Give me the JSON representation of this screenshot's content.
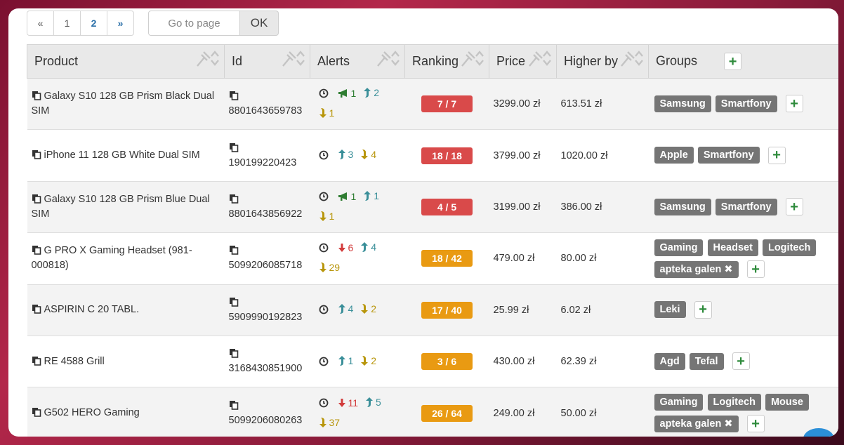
{
  "pagination": {
    "prev": "«",
    "pages": [
      "1",
      "2"
    ],
    "next": "»"
  },
  "goto": {
    "placeholder": "Go to page",
    "ok": "OK"
  },
  "columns": {
    "product": "Product",
    "id": "Id",
    "alerts": "Alerts",
    "ranking": "Ranking",
    "price": "Price",
    "higher_by": "Higher by",
    "groups": "Groups"
  },
  "add_label": "+",
  "remove_label": "✖",
  "colors": {
    "rank_red": "#d94a4a",
    "rank_orange": "#e99a12",
    "tag": "#757575",
    "add_green": "#2e8b3c"
  },
  "rows": [
    {
      "product": "Galaxy S10 128 GB Prism Black Dual SIM",
      "id": "8801643659783",
      "alerts": [
        {
          "icon": "megaphone-icon",
          "count": "1"
        },
        {
          "icon": "arrow-up-icon",
          "count": "2"
        },
        {
          "icon": "arrow-down-icon",
          "count": "1"
        }
      ],
      "ranking": "7 / 7",
      "price": "3299.00 zł",
      "higher_by": "613.51 zł",
      "groups": [
        "Samsung",
        "Smartfony"
      ]
    },
    {
      "product": "iPhone 11 128 GB White Dual SIM",
      "id": "190199220423",
      "alerts": [
        {
          "icon": "arrow-up-icon",
          "count": "3"
        },
        {
          "icon": "arrow-down-icon",
          "count": "4"
        }
      ],
      "ranking": "18 / 18",
      "price": "3799.00 zł",
      "higher_by": "1020.00 zł",
      "groups": [
        "Apple",
        "Smartfony"
      ]
    },
    {
      "product": "Galaxy S10 128 GB Prism Blue Dual SIM",
      "id": "8801643856922",
      "alerts": [
        {
          "icon": "megaphone-icon",
          "count": "1"
        },
        {
          "icon": "arrow-up-icon",
          "count": "1"
        },
        {
          "icon": "arrow-down-icon",
          "count": "1"
        }
      ],
      "ranking": "4 / 5",
      "price": "3199.00 zł",
      "higher_by": "386.00 zł",
      "groups": [
        "Samsung",
        "Smartfony"
      ]
    },
    {
      "product": "G PRO X Gaming Headset (981-000818)",
      "id": "5099206085718",
      "alerts": [
        {
          "icon": "red-arrow-down-icon",
          "count": "6"
        },
        {
          "icon": "arrow-up-icon",
          "count": "4"
        },
        {
          "icon": "arrow-down-icon",
          "count": "29"
        }
      ],
      "ranking": "18 / 42",
      "price": "479.00 zł",
      "higher_by": "80.00 zł",
      "groups": [
        "Gaming",
        "Headset",
        "Logitech"
      ],
      "extra_group": "apteka galen"
    },
    {
      "product": "ASPIRIN C 20 TABL.",
      "id": "5909990192823",
      "alerts": [
        {
          "icon": "arrow-up-icon",
          "count": "4"
        },
        {
          "icon": "arrow-down-icon",
          "count": "2"
        }
      ],
      "ranking": "17 / 40",
      "price": "25.99 zł",
      "higher_by": "6.02 zł",
      "groups": [
        "Leki"
      ]
    },
    {
      "product": "RE 4588 Grill",
      "id": "3168430851900",
      "alerts": [
        {
          "icon": "arrow-up-icon",
          "count": "1"
        },
        {
          "icon": "arrow-down-icon",
          "count": "2"
        }
      ],
      "ranking": "3 / 6",
      "price": "430.00 zł",
      "higher_by": "62.39 zł",
      "groups": [
        "Agd",
        "Tefal"
      ]
    },
    {
      "product": "G502 HERO Gaming",
      "id": "5099206080263",
      "alerts": [
        {
          "icon": "red-arrow-down-icon",
          "count": "11"
        },
        {
          "icon": "arrow-up-icon",
          "count": "5"
        },
        {
          "icon": "arrow-down-icon",
          "count": "37"
        }
      ],
      "ranking": "26 / 64",
      "price": "249.00 zł",
      "higher_by": "50.00 zł",
      "groups": [
        "Gaming",
        "Logitech",
        "Mouse"
      ],
      "extra_group": "apteka galen"
    }
  ]
}
